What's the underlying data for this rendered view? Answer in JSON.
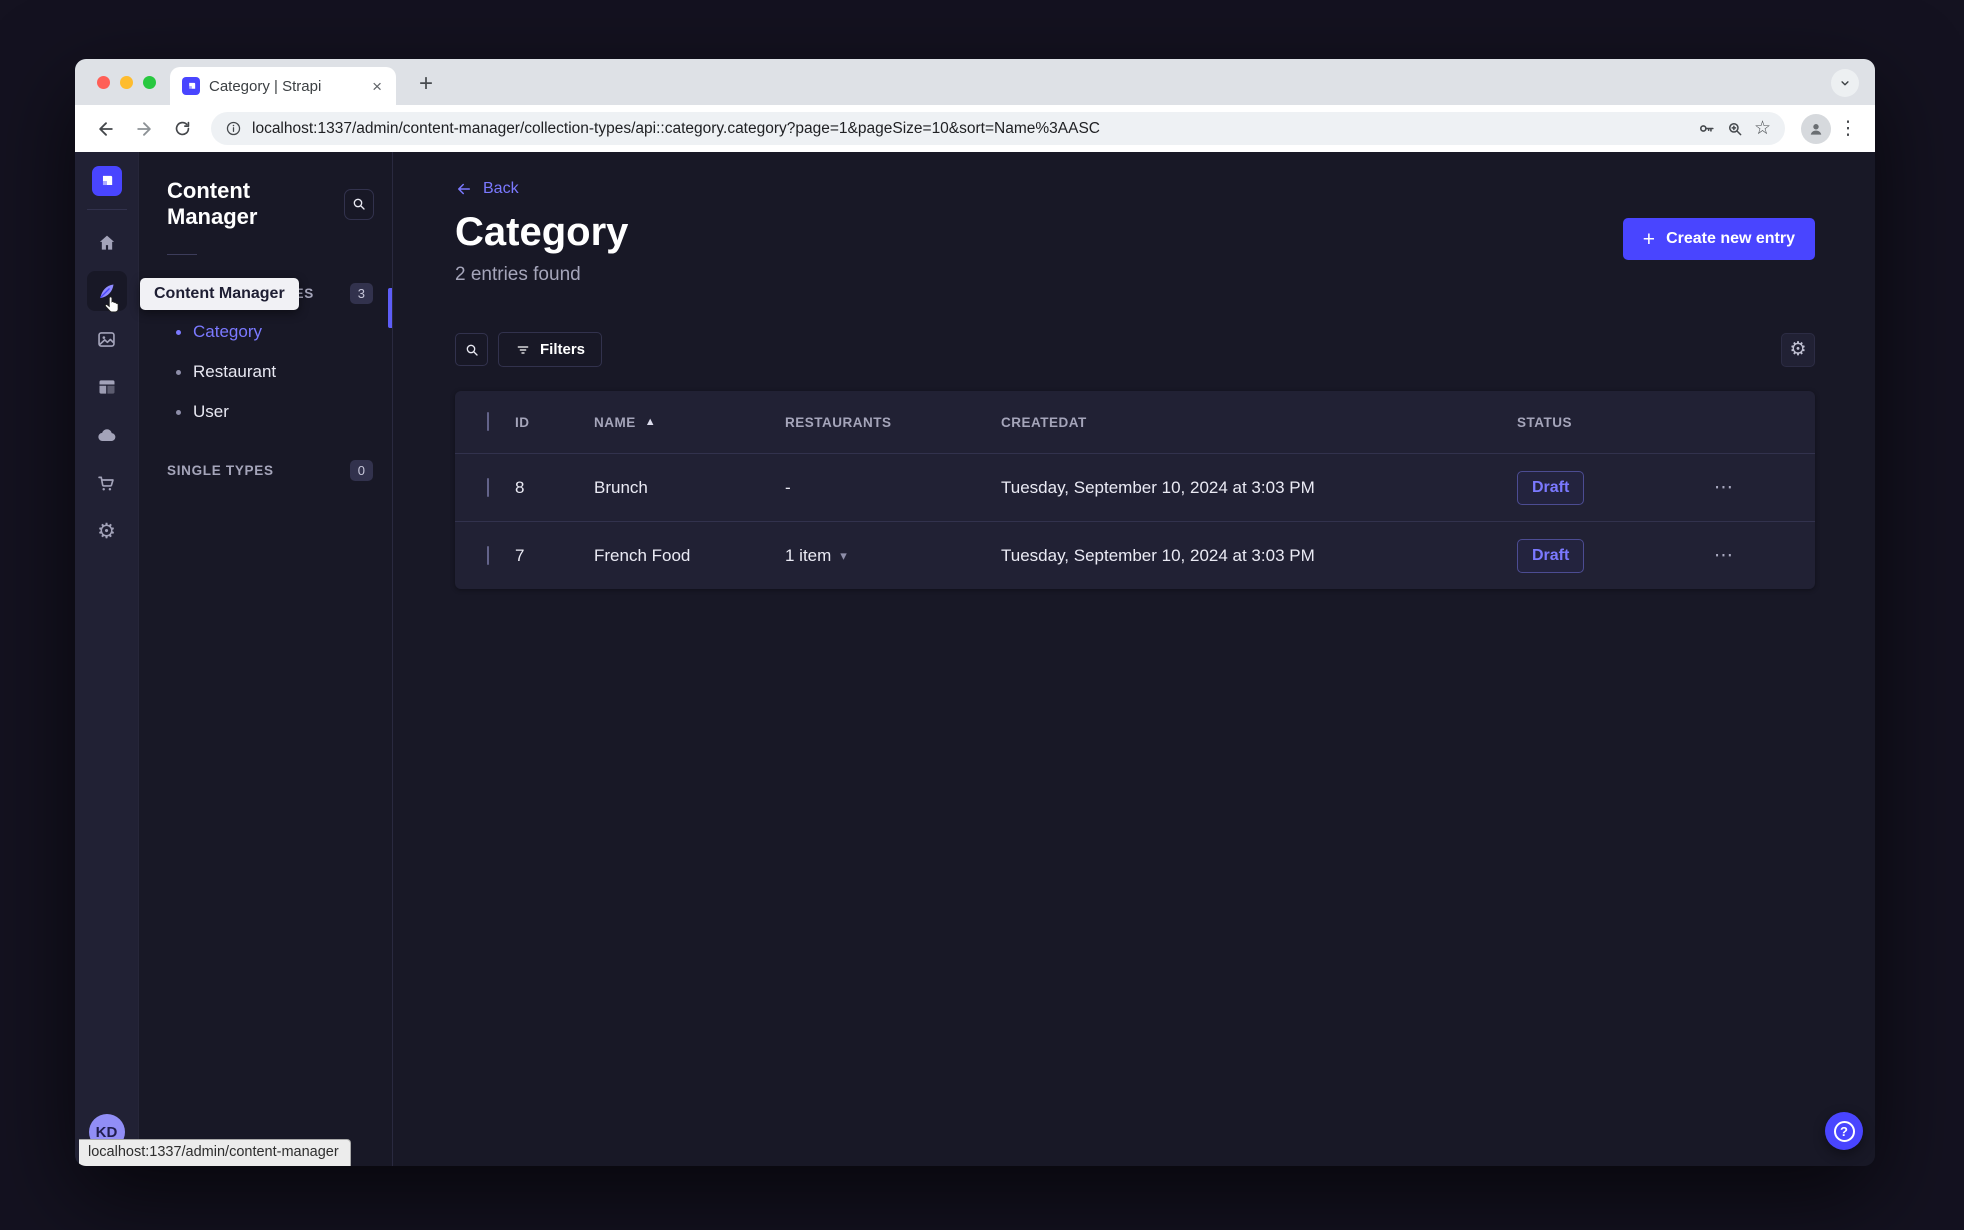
{
  "browser": {
    "tab_title": "Category | Strapi",
    "url": "localhost:1337/admin/content-manager/collection-types/api::category.category?page=1&pageSize=10&sort=Name%3AASC",
    "status_bubble": "localhost:1337/admin/content-manager",
    "icons": {
      "close_tab": "×",
      "new_tab": "+",
      "star": "☆",
      "menu": "⋮"
    }
  },
  "rail": {
    "tooltip": "Content Manager",
    "avatar_initials": "KD"
  },
  "subnav": {
    "title": "Content Manager",
    "collection_types": {
      "label": "COLLECTION TYPES",
      "badge": "3",
      "items": [
        {
          "label": "Category",
          "active": true
        },
        {
          "label": "Restaurant",
          "active": false
        },
        {
          "label": "User",
          "active": false
        }
      ]
    },
    "single_types": {
      "label": "SINGLE TYPES",
      "badge": "0"
    }
  },
  "main": {
    "back_label": "Back",
    "title": "Category",
    "entries_found": "2 entries found",
    "create_button_label": "Create new entry",
    "filters_label": "Filters",
    "table": {
      "headers": {
        "id": "ID",
        "name": "NAME",
        "restaurants": "RESTAURANTS",
        "createdat": "CREATEDAT",
        "status": "STATUS"
      },
      "rows": [
        {
          "id": "8",
          "name": "Brunch",
          "restaurants": "-",
          "createdat": "Tuesday, September 10, 2024 at 3:03 PM",
          "status": "Draft"
        },
        {
          "id": "7",
          "name": "French Food",
          "restaurants": "1 item",
          "createdat": "Tuesday, September 10, 2024 at 3:03 PM",
          "status": "Draft"
        }
      ]
    },
    "icons": {
      "plus": "+",
      "sort_asc": "▲",
      "caret_down": "▾",
      "row_actions": "⋯",
      "gear": "⚙",
      "help": "?"
    }
  },
  "colors": {
    "accent": "#4945ff",
    "link": "#7b79ff",
    "page_bg": "#181826",
    "card_bg": "#212134",
    "border": "#32324d",
    "muted_text": "#a5a5ba",
    "draft_text": "#7b79ff",
    "traffic_red": "#ff5f57",
    "traffic_yellow": "#febc2e",
    "traffic_green": "#28c840"
  }
}
